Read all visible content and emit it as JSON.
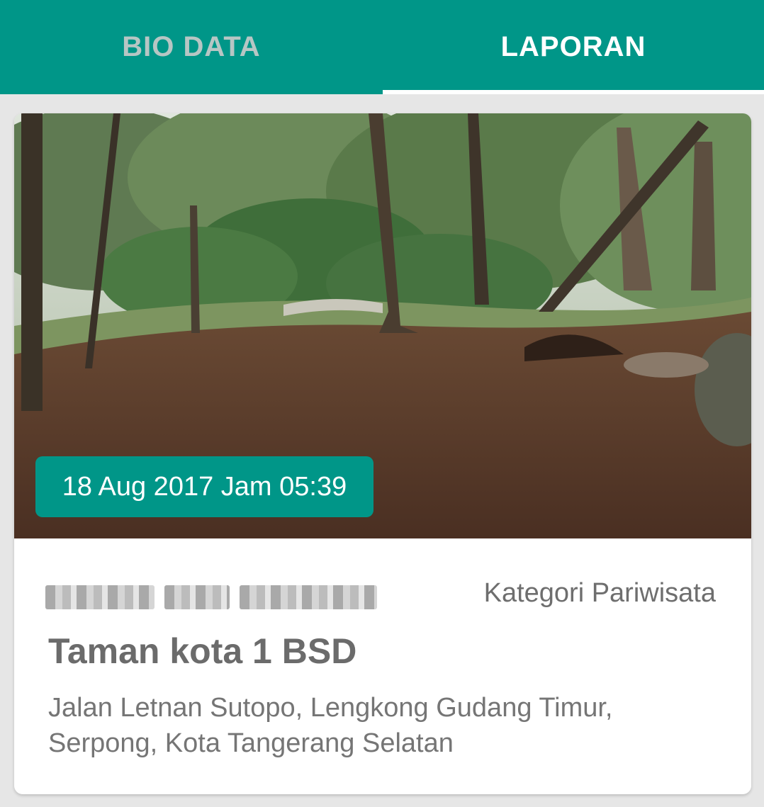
{
  "tabs": [
    {
      "label": "BIO DATA",
      "selected": false
    },
    {
      "label": "LAPORAN",
      "selected": true
    }
  ],
  "colors": {
    "primary": "#009688",
    "tab_inactive_text": "#b7c6c4"
  },
  "report": {
    "date_time": "18 Aug 2017 Jam 05:39",
    "author_name_blurred": true,
    "category": "Kategori Pariwisata",
    "title": "Taman kota 1 BSD",
    "address": "Jalan Letnan Sutopo, Lengkong Gudang Timur, Serpong, Kota Tangerang Selatan"
  }
}
